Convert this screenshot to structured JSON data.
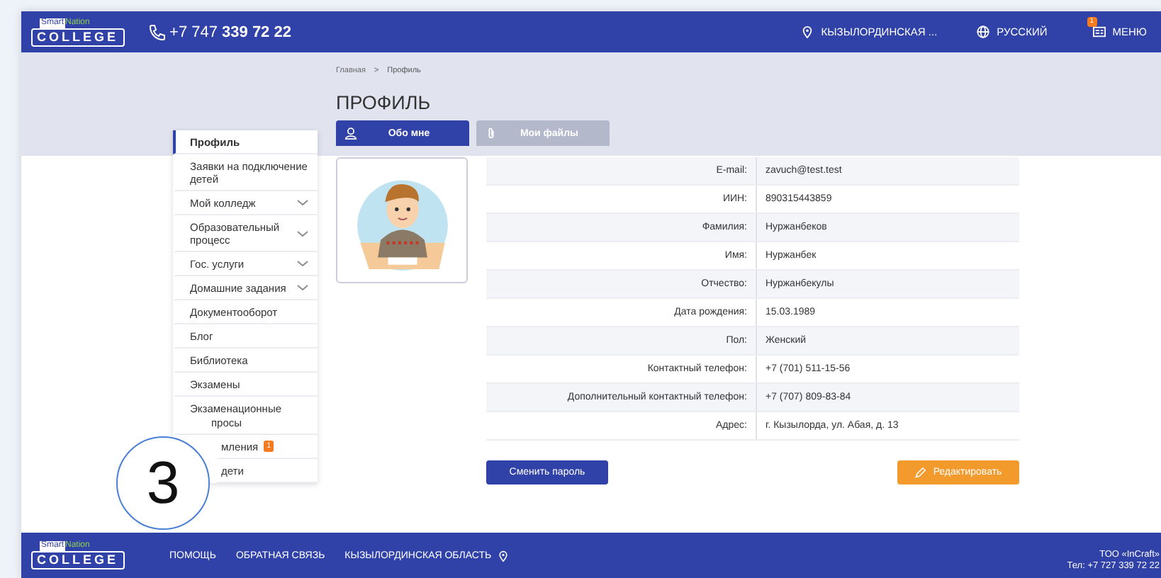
{
  "header": {
    "logo_smart": "Smart",
    "logo_nation": "Nation",
    "logo_main": "COLLEGE",
    "phone_prefix": "+7 747",
    "phone_number": "339 72 22",
    "region": "КЫЗЫЛОРДИНСКАЯ ...",
    "language": "РУССКИЙ",
    "menu": "МЕНЮ",
    "menu_badge": "1"
  },
  "breadcrumb": [
    "Главная",
    ">",
    "Профиль"
  ],
  "page_title": "ПРОФИЛЬ",
  "sidebar": {
    "items": [
      {
        "label": "Профиль",
        "selected": true,
        "expandable": false
      },
      {
        "label": "Заявки на подключение детей",
        "selected": false,
        "expandable": false
      },
      {
        "label": "Мой колледж",
        "selected": false,
        "expandable": true
      },
      {
        "label": "Образовательный процесс",
        "selected": false,
        "expandable": true
      },
      {
        "label": "Гос. услуги",
        "selected": false,
        "expandable": true
      },
      {
        "label": "Домашние задания",
        "selected": false,
        "expandable": true
      },
      {
        "label": "Документооборот",
        "selected": false,
        "expandable": false
      },
      {
        "label": "Блог",
        "selected": false,
        "expandable": false
      },
      {
        "label": "Библиотека",
        "selected": false,
        "expandable": false
      },
      {
        "label": "Экзамены",
        "selected": false,
        "expandable": false
      },
      {
        "label": "Экзаменационные",
        "continued": "просы",
        "selected": false,
        "expandable": false
      },
      {
        "label": "мления",
        "badge": "1",
        "covered": true,
        "selected": false,
        "expandable": false
      },
      {
        "label": "дети",
        "covered": true,
        "selected": false,
        "expandable": false
      }
    ]
  },
  "tabs": [
    {
      "label": "Обо мне",
      "selected": true
    },
    {
      "label": "Мои файлы",
      "selected": false
    }
  ],
  "profile": {
    "rows": [
      {
        "label": "E-mail:",
        "value": "zavuch@test.test"
      },
      {
        "label": "ИИН:",
        "value": "890315443859"
      },
      {
        "label": "Фамилия:",
        "value": "Нуржанбеков"
      },
      {
        "label": "Имя:",
        "value": "Нуржанбек"
      },
      {
        "label": "Отчество:",
        "value": "Нуржанбекулы"
      },
      {
        "label": "Дата рождения:",
        "value": "15.03.1989"
      },
      {
        "label": "Пол:",
        "value": "Женский"
      },
      {
        "label": "Контактный телефон:",
        "value": "+7 (701) 511-15-56"
      },
      {
        "label": "Дополнительный контактный телефон:",
        "value": "+7 (707) 809-83-84"
      },
      {
        "label": "Адрес:",
        "value": "г. Кызылорда, ул. Абая, д. 13"
      }
    ],
    "buttons": [
      {
        "label": "Сменить пароль",
        "kind": "primary"
      },
      {
        "label": "Редактировать",
        "kind": "edit"
      }
    ]
  },
  "footer": {
    "logo_smart": "Smart",
    "logo_nation": "Nation",
    "logo_main": "COLLEGE",
    "links": [
      "ПОМОЩЬ",
      "ОБРАТНАЯ СВЯЗЬ",
      "КЫЗЫЛОРДИНСКАЯ ОБЛАСТЬ"
    ],
    "company": "ТОО «InCraft»",
    "phone": "Тел: +7 727 339 72 22"
  },
  "annotation": {
    "label": "3"
  }
}
